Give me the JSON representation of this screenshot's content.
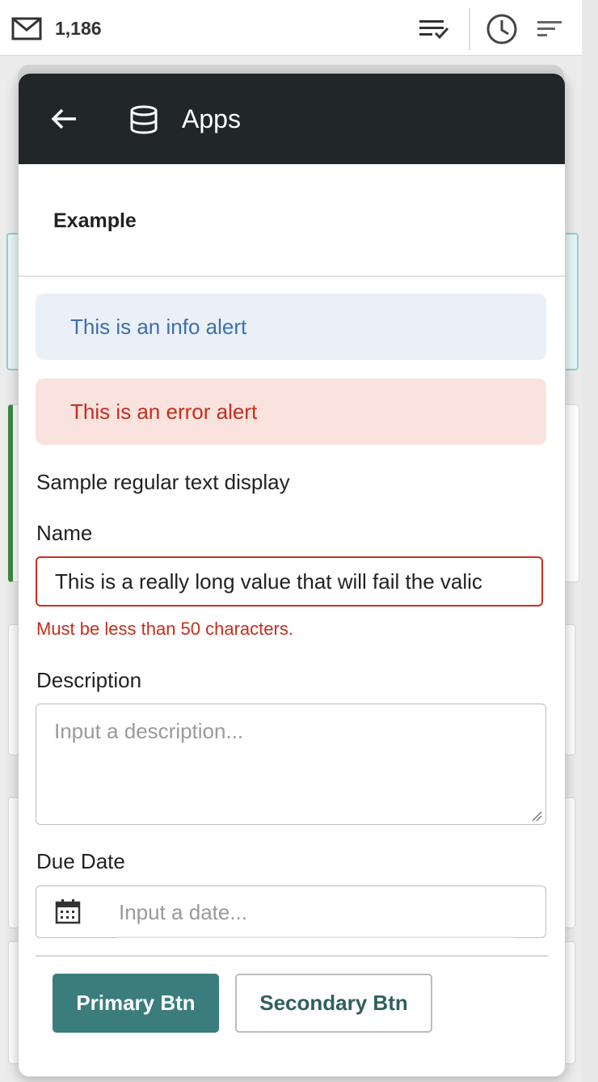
{
  "toolbar": {
    "mail_icon": "mail-icon",
    "unread_count": "1,186",
    "icons": [
      "list-check-icon",
      "clock-icon",
      "sort-icon"
    ]
  },
  "panel": {
    "title": "Apps",
    "back_icon": "arrow-left-icon",
    "app_icon": "database-icon",
    "section_title": "Example"
  },
  "alerts": {
    "info": "This is an info alert",
    "error": "This is an error alert"
  },
  "regular_text": "Sample regular text display",
  "form": {
    "name_label": "Name",
    "name_value": "This is a really long value that will fail the valic",
    "name_error": "Must be less than 50 characters.",
    "description_label": "Description",
    "description_placeholder": "Input a description...",
    "due_date_label": "Due Date",
    "due_date_placeholder": "Input a date..."
  },
  "buttons": {
    "primary": "Primary Btn",
    "secondary": "Secondary Btn"
  },
  "colors": {
    "header_bg": "#212729",
    "primary": "#3a7d7c",
    "error": "#c32f1e",
    "info": "#3f6eae"
  }
}
